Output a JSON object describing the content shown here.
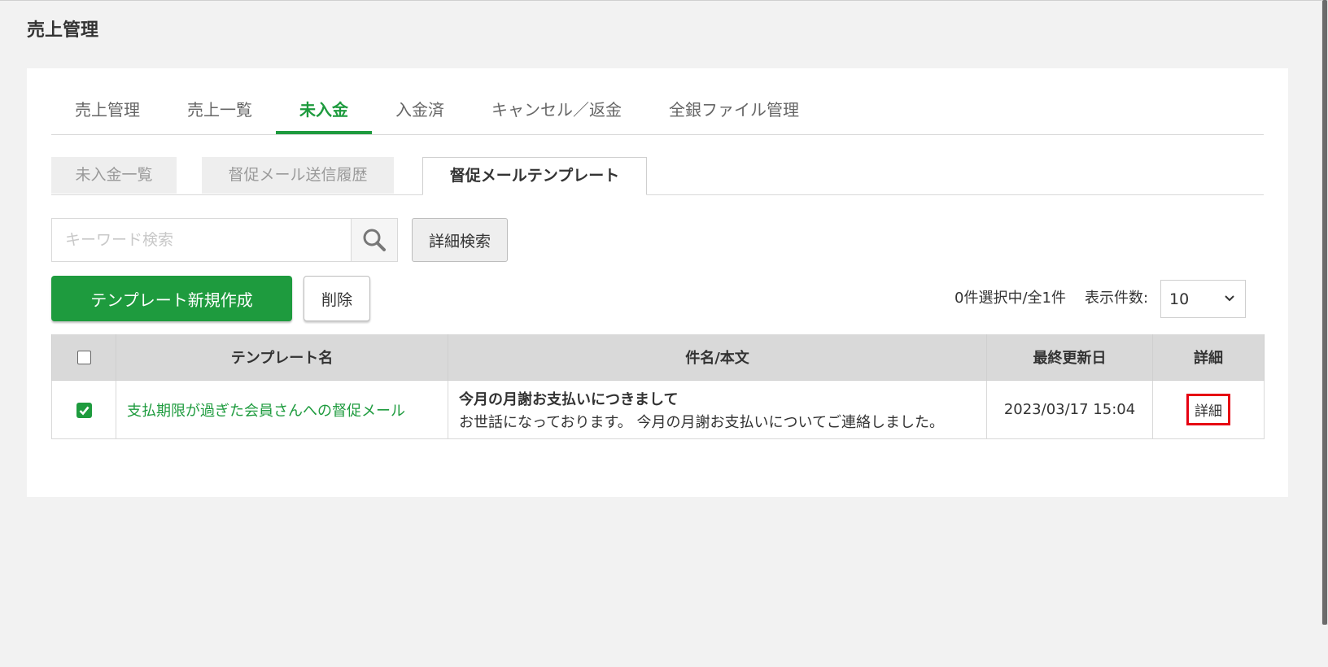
{
  "page": {
    "title": "売上管理"
  },
  "main_tabs": [
    {
      "label": "売上管理"
    },
    {
      "label": "売上一覧"
    },
    {
      "label": "未入金"
    },
    {
      "label": "入金済"
    },
    {
      "label": "キャンセル／返金"
    },
    {
      "label": "全銀ファイル管理"
    }
  ],
  "main_tabs_active": "未入金",
  "sub_tabs": [
    {
      "label": "未入金一覧"
    },
    {
      "label": "督促メール送信履歴"
    },
    {
      "label": "督促メールテンプレート"
    }
  ],
  "sub_tabs_active": "督促メールテンプレート",
  "search": {
    "placeholder": "キーワード検索",
    "value": "",
    "advanced_label": "詳細検索"
  },
  "actions": {
    "new_template_label": "テンプレート新規作成",
    "delete_label": "削除"
  },
  "list_info": {
    "selection_status": "0件選択中/全1件",
    "per_page_label": "表示件数:",
    "per_page_value": "10"
  },
  "table": {
    "headers": {
      "name": "テンプレート名",
      "subject_body": "件名/本文",
      "updated": "最終更新日",
      "detail": "詳細"
    },
    "rows": [
      {
        "checked": true,
        "name": "支払期限が過ぎた会員さんへの督促メール",
        "subject": "今月の月謝お支払いにつきまして",
        "body": "お世話になっております。 今月の月謝お支払いについてご連絡しました。",
        "updated": "2023/03/17 15:04",
        "detail_label": "詳細"
      }
    ]
  },
  "colors": {
    "accent": "#1e9b3e",
    "highlight": "#e60012",
    "background": "#f2f2f2"
  }
}
